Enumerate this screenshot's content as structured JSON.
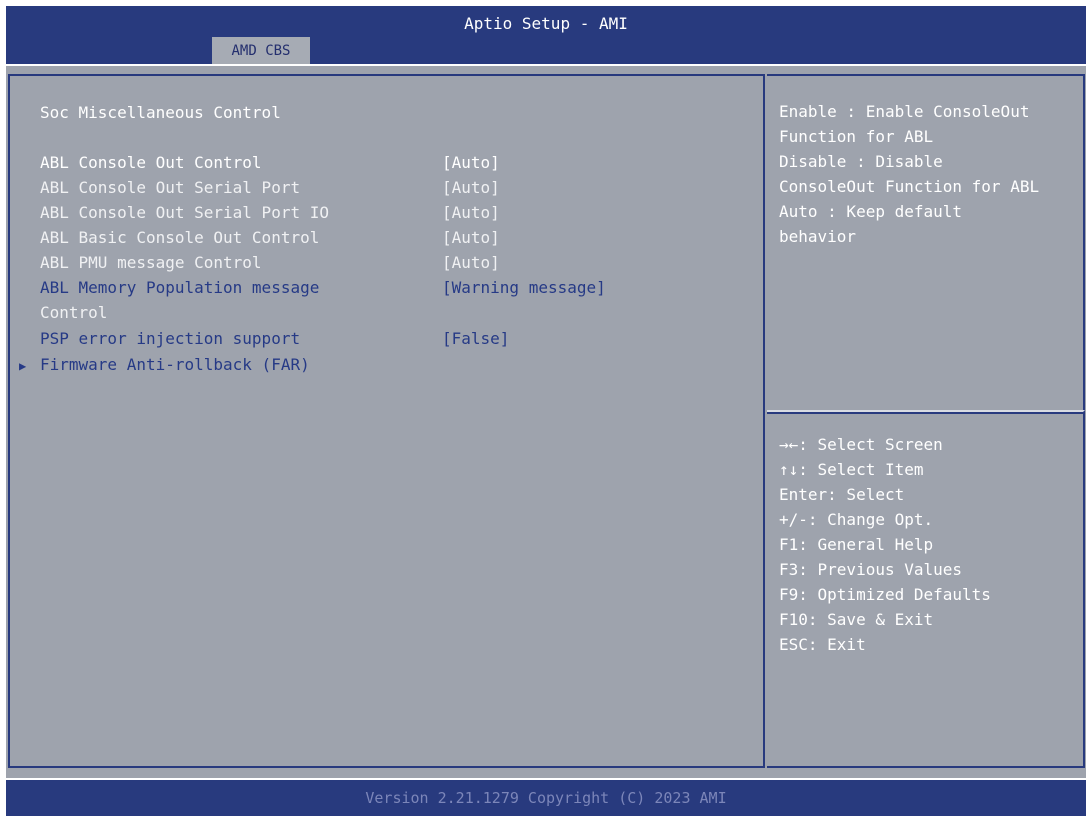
{
  "header": {
    "title": "Aptio Setup - AMI",
    "tab": "AMD CBS"
  },
  "main": {
    "section_title": "Soc Miscellaneous Control",
    "items": [
      {
        "label": "ABL Console Out Control",
        "value": "[Auto]"
      },
      {
        "label": "ABL Console Out Serial Port",
        "value": "[Auto]"
      },
      {
        "label": "ABL Console Out Serial Port IO",
        "value": "[Auto]"
      },
      {
        "label": "ABL Basic Console Out Control",
        "value": "[Auto]"
      },
      {
        "label": "ABL PMU message Control",
        "value": "[Auto]"
      },
      {
        "label": "ABL Memory Population message",
        "label2": "Control",
        "value": "[Warning message]"
      },
      {
        "label": "PSP error injection support",
        "value": "[False]"
      }
    ],
    "submenu": {
      "label": "Firmware Anti-rollback (FAR)"
    }
  },
  "help": {
    "lines": [
      "Enable : Enable ConsoleOut",
      "Function for ABL",
      "Disable : Disable",
      "ConsoleOut Function for ABL",
      "Auto : Keep default",
      "behavior"
    ]
  },
  "keys": {
    "lines": [
      "→←: Select Screen",
      "↑↓: Select Item",
      "Enter: Select",
      "+/-: Change Opt.",
      "F1: General Help",
      "F3: Previous Values",
      "F9: Optimized Defaults",
      "F10: Save & Exit",
      "ESC: Exit"
    ]
  },
  "footer": {
    "text": "Version 2.21.1279 Copyright (C) 2023 AMI"
  },
  "colors": {
    "frame_blue": "#283a7e",
    "panel_grey": "#9ea3ad",
    "highlight_text": "#ffffff",
    "option_text": "#263a86"
  }
}
